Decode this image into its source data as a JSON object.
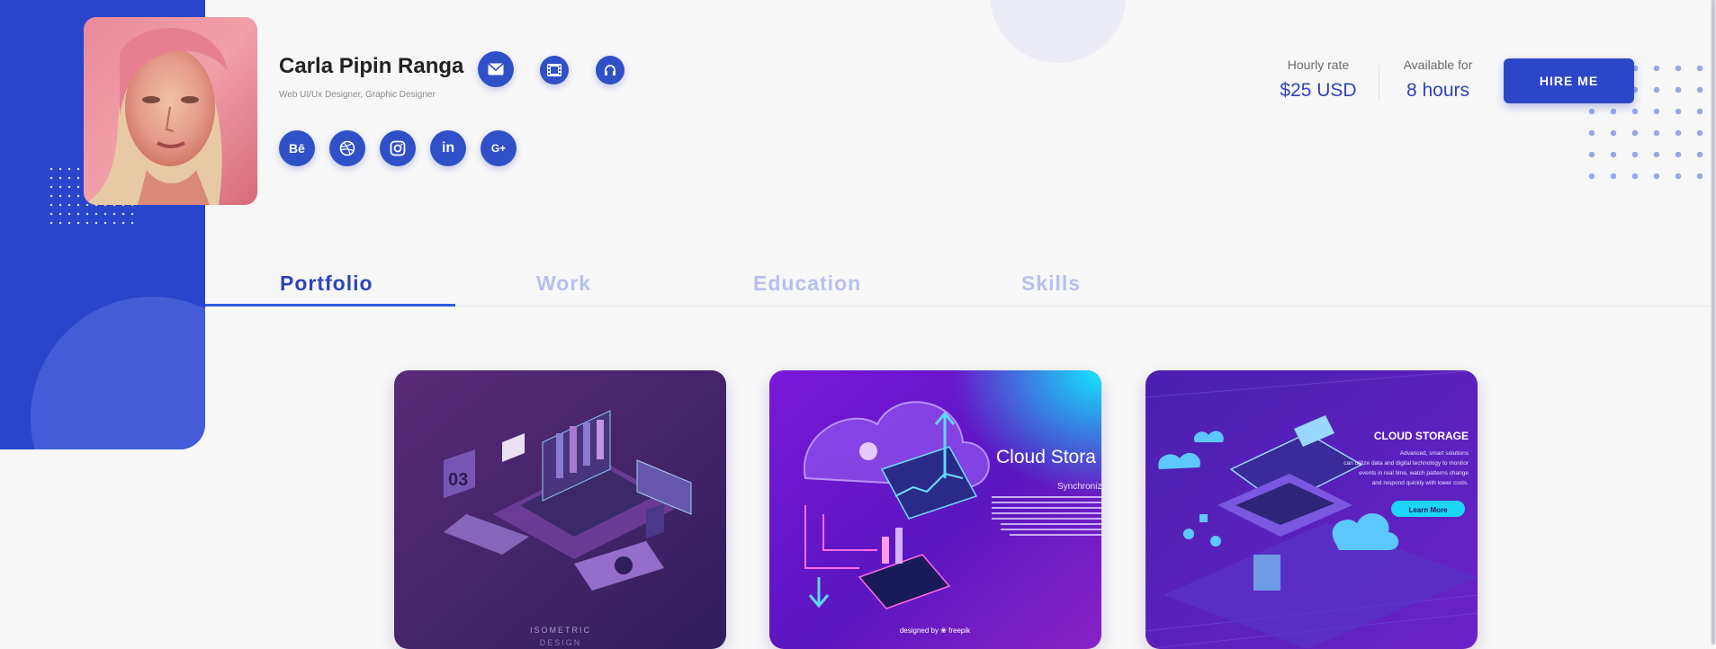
{
  "profile": {
    "name": "Carla Pipin Ranga",
    "subtitle": "Web UI/Ux Designer, Graphic Designer"
  },
  "contact_icons": [
    "mail-icon",
    "film-icon",
    "headphones-icon"
  ],
  "socials": [
    {
      "name": "behance-icon",
      "label": "Bē"
    },
    {
      "name": "dribbble-icon",
      "label": ""
    },
    {
      "name": "instagram-icon",
      "label": ""
    },
    {
      "name": "linkedin-icon",
      "label": "in"
    },
    {
      "name": "google-plus-icon",
      "label": "G+"
    }
  ],
  "stats": {
    "hourly_label": "Hourly rate",
    "hourly_value": "$25 USD",
    "available_label": "Available for",
    "available_value": "8 hours"
  },
  "hire_label": "HIRE ME",
  "tabs": [
    {
      "label": "Portfolio",
      "active": true
    },
    {
      "label": "Work",
      "active": false
    },
    {
      "label": "Education",
      "active": false
    },
    {
      "label": "Skills",
      "active": false
    }
  ],
  "cards": [
    {
      "caption": "ISOMETRIC",
      "caption2": "DESIGN"
    },
    {
      "title": "Cloud Stora",
      "subtitle": "Synchroniz",
      "credit": "designed by ❀ freepik"
    },
    {
      "title": "CLOUD STORAGE",
      "desc1": "Advanced, smart solutions",
      "desc2": "can utilize data and digital technology to monitor",
      "desc3": "events in real time, watch patterns change",
      "desc4": "and respond quickly with lower costs.",
      "button": "Learn More"
    }
  ],
  "colors": {
    "accent": "#2a44cc",
    "tab_inactive": "#b8bff0",
    "tab_active": "#2e44b6"
  }
}
